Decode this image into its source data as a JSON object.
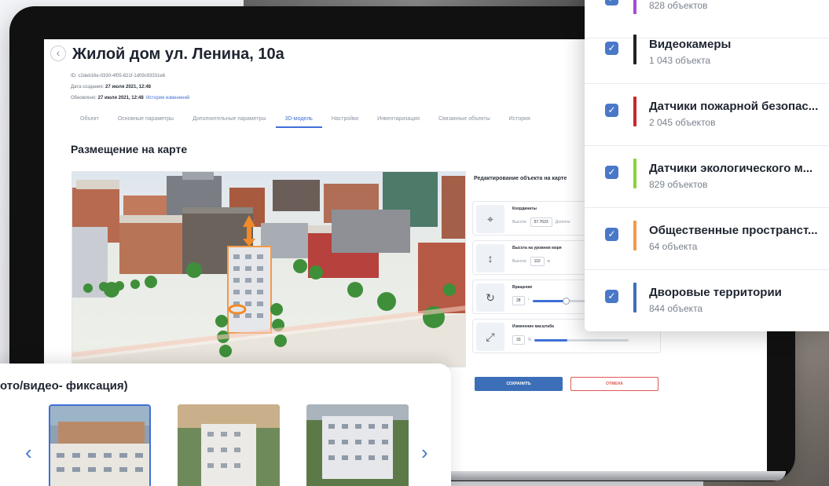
{
  "object": {
    "title": "Жилой дом ул. Ленина, 10а",
    "id_line": "ID: c2deb16e-0330-4f05-821f-1d09c93331e6",
    "created_label": "Дата создания:",
    "created_value": "27 июля 2021, 12:48",
    "updated_label": "Обновлено:",
    "updated_value": "27 июля 2021, 12:48",
    "history_link": "История изменений"
  },
  "tabs": [
    {
      "label": "Объект"
    },
    {
      "label": "Основные параметры"
    },
    {
      "label": "Дополнительные параметры"
    },
    {
      "label": "3D-модель",
      "active": true
    },
    {
      "label": "Настройки"
    },
    {
      "label": "Инвентаризация"
    },
    {
      "label": "Связанные объекты"
    },
    {
      "label": "История"
    }
  ],
  "section_title": "Размещение на карте",
  "edit": {
    "title": "Редактирование объекта на карте",
    "coords": {
      "label": "Координаты",
      "height_label": "Высота:",
      "height_value": "57.7623",
      "extra_label": "Долгота:"
    },
    "altitude": {
      "label": "Высота на уровнем моря",
      "height_label": "Высота:",
      "value": "110",
      "unit": "м"
    },
    "rotation": {
      "label": "Вращение",
      "value": "28",
      "unit": "°",
      "level": 0.35
    },
    "scale": {
      "label": "Изменение масштаба",
      "value": "33",
      "unit": "%",
      "level": 0.35
    },
    "save_label": "СОХРАНИТЬ",
    "cancel_label": "ОТМЕНА"
  },
  "layers": [
    {
      "name": "",
      "count": "828 объектов",
      "color": "#a64ad8"
    },
    {
      "name": "Видеокамеры",
      "count": "1 043 объекта",
      "color": "#222222"
    },
    {
      "name": "Датчики пожарной безопас...",
      "count": "2 045 объектов",
      "color": "#c8262c"
    },
    {
      "name": "Датчики экологического м...",
      "count": "829 объектов",
      "color": "#8bd33a"
    },
    {
      "name": "Общественные пространст...",
      "count": "64 объекта",
      "color": "#f29a4a"
    },
    {
      "name": "Дворовые территории",
      "count": "844 объекта",
      "color": "#3c6fb8"
    }
  ],
  "photo": {
    "title": "ото/видео- фиксация)",
    "prev_icon": "chevron-left-icon",
    "next_icon": "chevron-right-icon"
  }
}
